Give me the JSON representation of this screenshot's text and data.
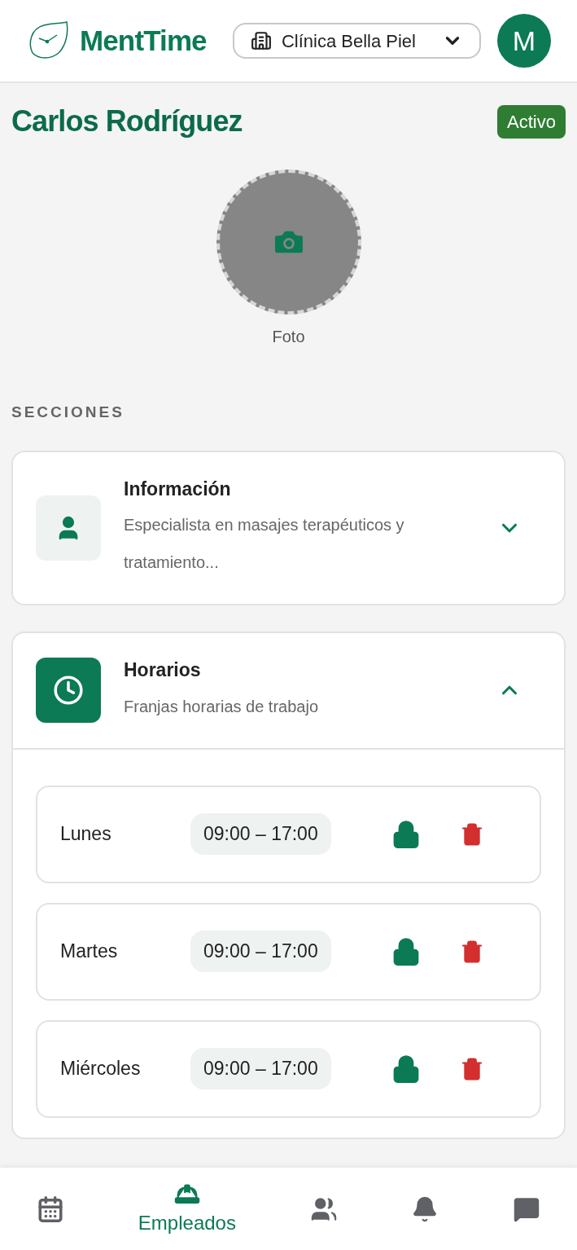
{
  "header": {
    "brand": "MentTime",
    "clinic": "Clínica Bella Piel",
    "avatar_initial": "M"
  },
  "employee": {
    "name": "Carlos Rodríguez",
    "status": "Activo",
    "photo_label": "Foto"
  },
  "sections_title": "SECCIONES",
  "sections": [
    {
      "kind": "info",
      "title": "Información",
      "subtitle": "Especialista en masajes terapéuticos y tratamiento...",
      "expanded": false
    },
    {
      "kind": "schedule",
      "title": "Horarios",
      "subtitle": "Franjas horarias de trabajo",
      "expanded": true,
      "rows": [
        {
          "day": "Lunes",
          "time": "09:00 – 17:00",
          "locked": true
        },
        {
          "day": "Martes",
          "time": "09:00 – 17:00",
          "locked": true
        },
        {
          "day": "Miércoles",
          "time": "09:00 – 17:00",
          "locked": true
        }
      ]
    }
  ],
  "bottom_nav": [
    {
      "kind": "calendar",
      "selected": false
    },
    {
      "kind": "employees",
      "label": "Empleados",
      "selected": true
    },
    {
      "kind": "clients",
      "selected": false
    },
    {
      "kind": "notifications",
      "selected": false
    },
    {
      "kind": "messages",
      "selected": false
    }
  ]
}
